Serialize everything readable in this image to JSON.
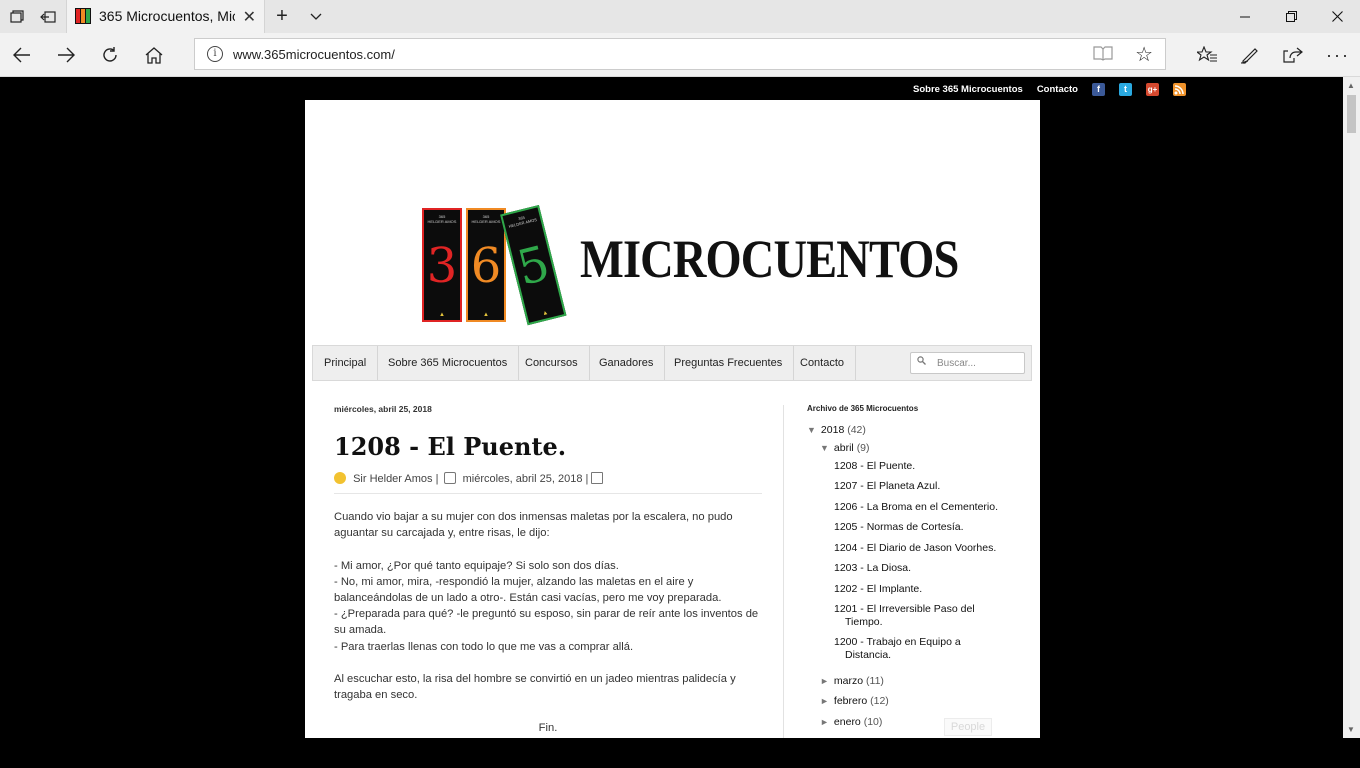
{
  "browser": {
    "tab_title": "365 Microcuentos, Micr",
    "url": "www.365microcuentos.com/",
    "icons": {
      "tab_actions": "tab-actions-icon",
      "set_aside": "set-aside-tabs-icon",
      "new_tab": "plus-icon",
      "tab_list": "chevron-down-icon",
      "minimize": "minimize-icon",
      "restore": "restore-icon",
      "close": "close-icon",
      "back": "back-arrow-icon",
      "forward": "forward-arrow-icon",
      "refresh": "refresh-icon",
      "home": "home-icon",
      "info": "info-icon",
      "reading_view": "reading-view-icon",
      "favorite": "star-icon",
      "favorites_hub": "favorites-hub-icon",
      "notes": "pen-icon",
      "share": "share-icon",
      "more": "more-icon"
    }
  },
  "site": {
    "top_links": [
      "Sobre 365 Microcuentos",
      "Contacto"
    ],
    "social": [
      {
        "name": "facebook-icon",
        "glyph": "f",
        "color": "#3b5998"
      },
      {
        "name": "twitter-icon",
        "glyph": "t",
        "color": "#2aa9e0"
      },
      {
        "name": "googleplus-icon",
        "glyph": "g+",
        "color": "#d6492f"
      },
      {
        "name": "rss-icon",
        "glyph": ")",
        "color": "#f0932b"
      }
    ],
    "logo": {
      "digits": [
        "3",
        "6",
        "5"
      ],
      "digit_colors": [
        "#e02424",
        "#f08a24",
        "#2fa84a"
      ],
      "book_caption": "365 HELDER AMOS",
      "word": "MICROCUENTOS"
    },
    "menu": [
      "Principal",
      "Sobre 365 Microcuentos",
      "Concursos",
      "Ganadores",
      "Preguntas Frecuentes",
      "Contacto"
    ],
    "search_placeholder": "Buscar..."
  },
  "post": {
    "date_header": "miércoles, abril 25, 2018",
    "title": "1208 - El Puente.",
    "author": "Sir Helder Amos",
    "date": "miércoles, abril 25, 2018",
    "sep": "|",
    "paragraphs": [
      "Cuando vio bajar a su mujer con dos inmensas maletas por la escalera, no pudo aguantar su carcajada y, entre risas, le dijo:",
      "- Mi amor, ¿Por qué tanto equipaje? Si solo son dos días.\n- No, mi amor, mira, -respondió la mujer, alzando las maletas en el aire y balanceándolas de un lado a otro-. Están casi vacías, pero me voy preparada.\n- ¿Preparada para qué? -le preguntó su esposo, sin parar de reír ante los inventos de su amada.\n- Para traerlas llenas con todo lo que me vas a comprar allá.",
      "Al escuchar esto, la risa del hombre se convirtió en un jadeo mientras palidecía y tragaba en seco."
    ],
    "end": "Fin."
  },
  "sidebar": {
    "title": "Archivo de 365 Microcuentos",
    "year": {
      "label": "2018",
      "count": "(42)"
    },
    "april": {
      "label": "abril",
      "count": "(9)"
    },
    "posts": [
      "1208 - El Puente.",
      "1207 - El Planeta Azul.",
      "1206 - La Broma en el Cementerio.",
      "1205 - Normas de Cortesía.",
      "1204 - El Diario de Jason Voorhes.",
      "1203 - La Diosa.",
      "1202 - El Implante.",
      "1201 - El Irreversible Paso del Tiempo.",
      "1200 - Trabajo en Equipo a Distancia."
    ],
    "months": [
      {
        "label": "marzo",
        "count": "(11)"
      },
      {
        "label": "febrero",
        "count": "(12)"
      },
      {
        "label": "enero",
        "count": "(10)"
      }
    ],
    "expanded_marker": "▼",
    "collapsed_marker": "►",
    "people_label": "People"
  }
}
